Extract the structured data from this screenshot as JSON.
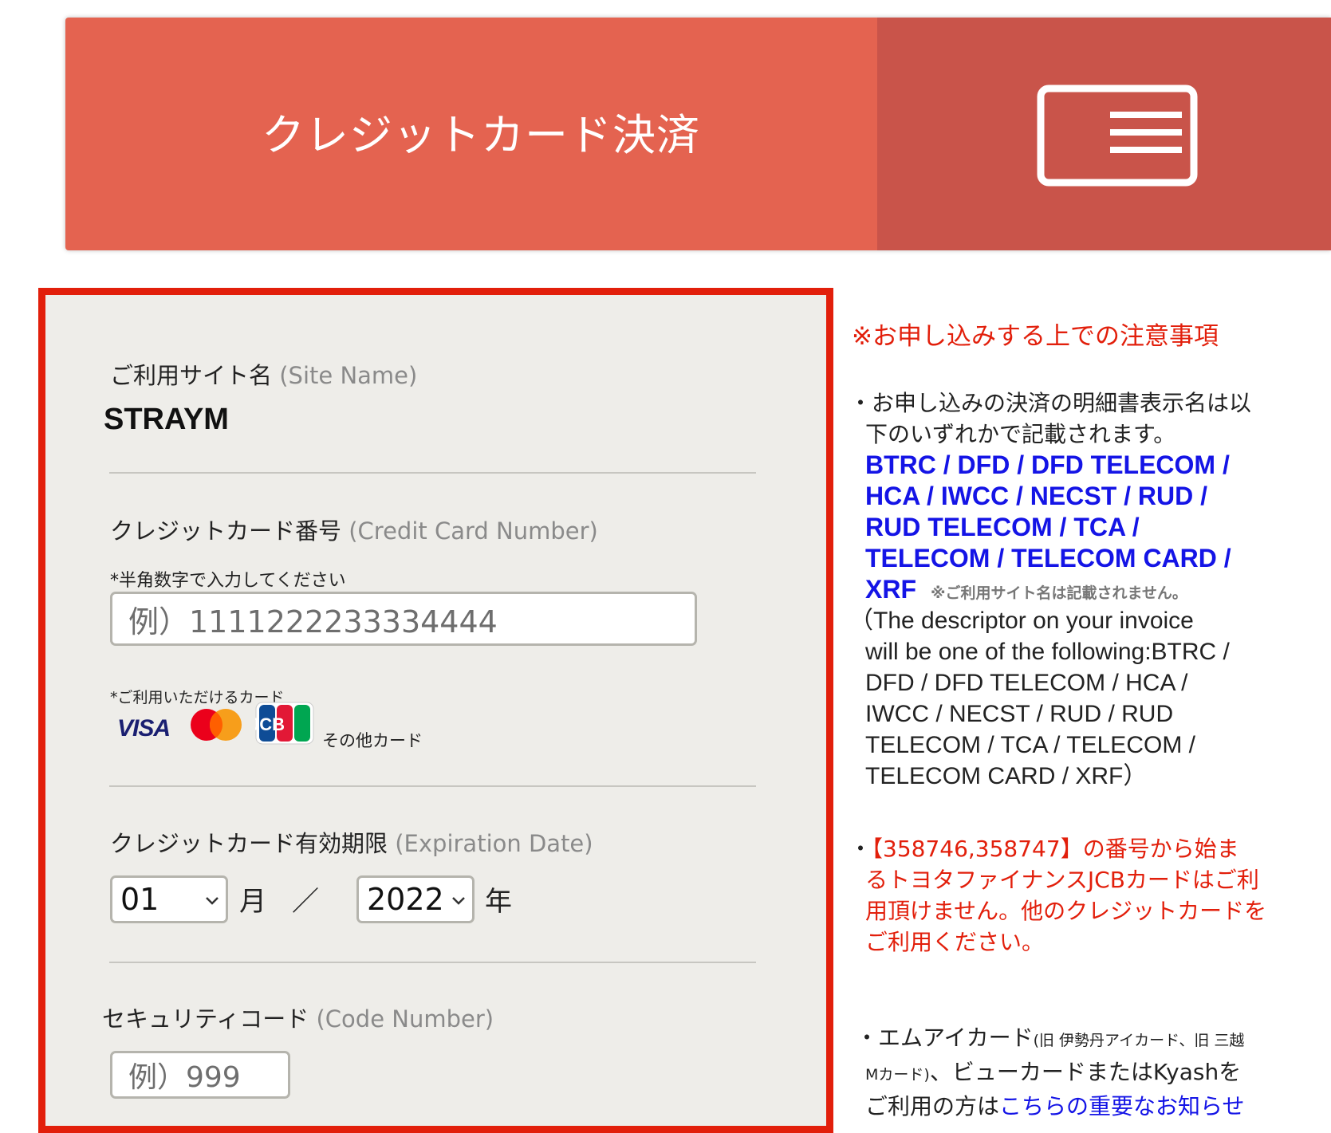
{
  "header": {
    "title": "クレジットカード決済",
    "icon": "credit-card-icon"
  },
  "form": {
    "site_name_label": "ご利用サイト名",
    "site_name_label_en": "(Site Name)",
    "site_name_value": "STRAYM",
    "card_number_label": "クレジットカード番号",
    "card_number_label_en": "(Credit Card Number)",
    "card_number_hint": "*半角数字で入力してください",
    "card_number_placeholder": "例）1111222233334444",
    "accepted_cards_label": "*ご利用いただけるカード",
    "brands": {
      "visa": "VISA",
      "mastercard": "mastercard-logo",
      "jcb": "JCB",
      "other": "その他カード"
    },
    "expiry_label": "クレジットカード有効期限",
    "expiry_label_en": "(Expiration Date)",
    "expiry_month": "01",
    "month_unit": "月",
    "separator": "／",
    "expiry_year": "2022",
    "year_unit": "年",
    "cvc_label": "セキュリティコード",
    "cvc_label_en": "(Code Number)",
    "cvc_placeholder": "例）999"
  },
  "notice": {
    "title": "※お申し込みする上での注意事項",
    "p1_line1": "・お申し込みの決済の明細書表示名は以",
    "p1_line2": "下のいずれかで記載されます。",
    "descriptor_line1": "BTRC / DFD / DFD TELECOM /",
    "descriptor_line2": "HCA / IWCC / NECST / RUD /",
    "descriptor_line3": "RUD TELECOM / TCA /",
    "descriptor_line4": "TELECOM / TELECOM CARD /",
    "descriptor_line5": "XRF",
    "site_name_note": "※ご利用サイト名は記載されません。",
    "en_line1": "（The descriptor on your invoice",
    "en_line2": "will be one of the following:BTRC /",
    "en_line3": "DFD / DFD TELECOM / HCA /",
    "en_line4": "IWCC / NECST / RUD / RUD",
    "en_line5": "TELECOM / TCA / TELECOM /",
    "en_line6": "TELECOM CARD / XRF）",
    "red_bullet": "・",
    "red_line1": "【358746,358747】の番号から始ま",
    "red_line2": "るトヨタファイナンスJCBカードはご利",
    "red_line3": "用頂けません。他のクレジットカードを",
    "red_line4": "ご利用ください。",
    "p3_line1_main": "・エムアイカード",
    "p3_line1_small": "(旧 伊勢丹アイカード、旧 三越",
    "p3_line2_small": "Mカード)",
    "p3_line2_main": "、ビューカードまたはKyashを",
    "p3_line3_main": "ご利用の方は",
    "p3_line3_link": "こちらの重要なお知らせ"
  }
}
